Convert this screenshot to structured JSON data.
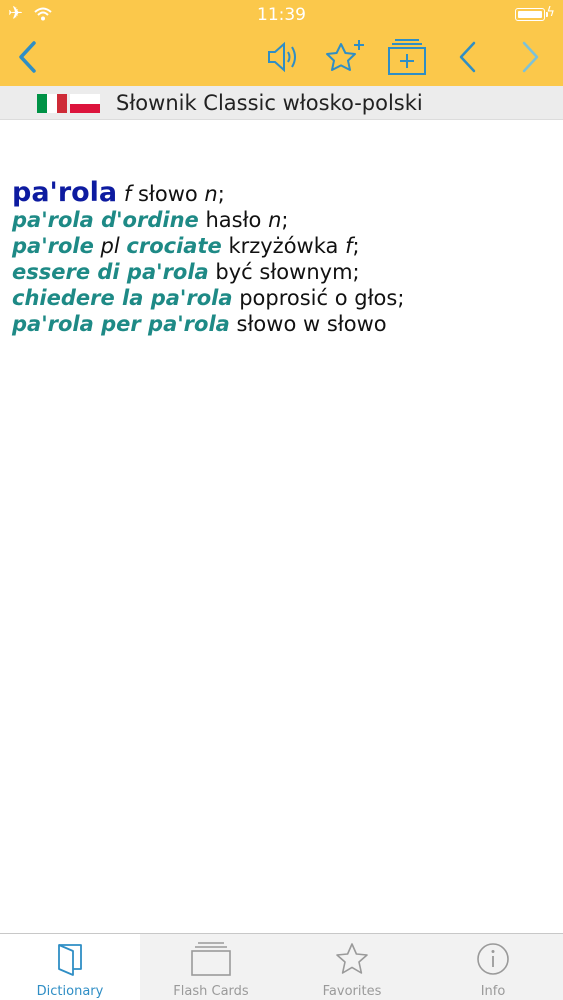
{
  "status_bar": {
    "time": "11:39",
    "airplane_icon": "airplane-icon",
    "wifi_icon": "wifi-icon",
    "battery_icon": "battery-icon",
    "charging_icon": "charging-icon"
  },
  "toolbar": {
    "back_icon": "chevron-left-icon",
    "speaker_icon": "speaker-icon",
    "add_favorite_icon": "star-plus-icon",
    "add_flashcard_icon": "card-plus-icon",
    "previous_icon": "chevron-left-icon",
    "next_icon": "chevron-right-icon",
    "next_enabled": false
  },
  "dictionary": {
    "title": "Słownik Classic włosko-polski",
    "source_flag": "Italian flag",
    "target_flag": "Polish flag"
  },
  "entry": {
    "headword": "pa'rola",
    "gender": "f",
    "translation": "słowo",
    "translation_gender": "n",
    "phrases": [
      {
        "p1": "pa'rola d'ordine",
        "t": "hasło",
        "g": "n",
        "end": ";"
      },
      {
        "p1": "pa'role",
        "pl": "pl",
        "p2": "crociate",
        "t": "krzyżówka",
        "g": "f",
        "end": ";"
      },
      {
        "p1": "essere di pa'rola",
        "t": "być słownym",
        "end": ";"
      },
      {
        "p1": "chiedere la pa'rola",
        "t": "poprosić o głos",
        "end": ";"
      },
      {
        "p1": "pa'rola per pa'rola",
        "t": "słowo w słowo"
      }
    ]
  },
  "tabs": [
    {
      "label": "Dictionary",
      "icon": "book-icon",
      "active": true
    },
    {
      "label": "Flash Cards",
      "icon": "flash-cards-icon",
      "active": false
    },
    {
      "label": "Favorites",
      "icon": "star-icon",
      "active": false
    },
    {
      "label": "Info",
      "icon": "info-icon",
      "active": false
    }
  ],
  "colors": {
    "header": "#fbc84b",
    "accent": "#2f8ec5",
    "headword": "#0d1ba0",
    "phrase": "#1e8a86",
    "disabled": "#7cc2d9"
  }
}
